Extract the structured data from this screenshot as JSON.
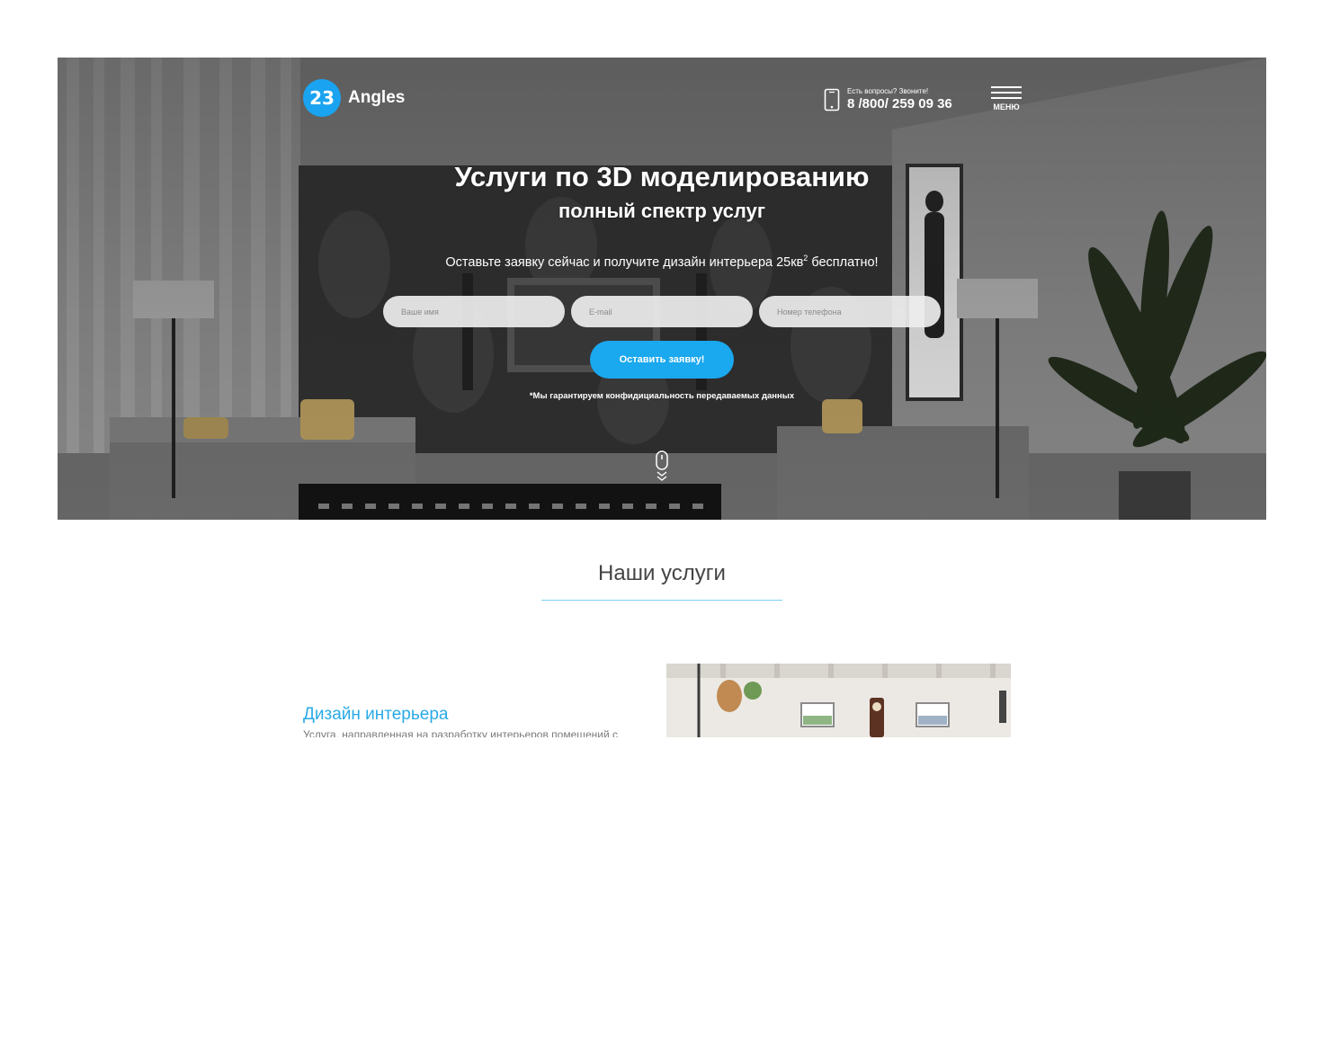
{
  "header": {
    "logo_number": "23",
    "logo_text": "Angles",
    "phone_caption": "Есть вопросы? Звоните!",
    "phone_number": "8 /800/ 259 09 36",
    "menu_label": "МЕНЮ"
  },
  "hero": {
    "title": "Услуги по 3D моделированию",
    "subtitle": "полный спектр услуг",
    "offer_text": "Оставьте заявку сейчас и получите дизайн интерьера 25кв",
    "offer_sup": "2",
    "offer_end": " бесплатно!",
    "form": {
      "name_placeholder": "Ваше имя",
      "email_placeholder": "E-mail",
      "phone_placeholder": "Номер телефона",
      "submit_label": "Оставить заявку!"
    },
    "privacy_note": "*Мы гарантируем конфидициальность передаваемых данных"
  },
  "services": {
    "title": "Наши услуги",
    "items": [
      {
        "name": "Дизайн интерьера",
        "description": "Услуга, направленная на разработку интерьеров помещений с"
      }
    ]
  },
  "colors": {
    "accent": "#1aa8ee",
    "service_title": "#2aaae6",
    "divider": "#7fd0f5"
  }
}
